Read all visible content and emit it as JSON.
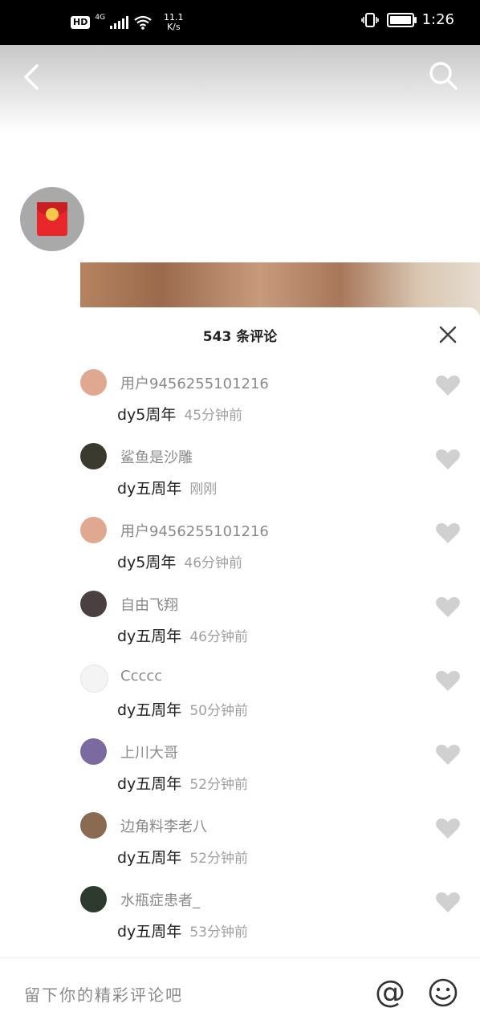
{
  "status_bar": {
    "hd": "HD",
    "network": "4G",
    "speed_value": "11.1",
    "speed_unit": "K/s",
    "time": "1:26"
  },
  "comments_panel": {
    "title": "543 条评论",
    "comments": [
      {
        "user": "用户9456255101216",
        "text": "dy5周年",
        "time": "45分钟前",
        "avatar_color": "#e0a890"
      },
      {
        "user": "鲨鱼是沙雕",
        "text": "dy五周年",
        "time": "刚刚",
        "avatar_color": "#3a3a2e"
      },
      {
        "user": "用户9456255101216",
        "text": "dy5周年",
        "time": "46分钟前",
        "avatar_color": "#e0a890"
      },
      {
        "user": "自由飞翔",
        "text": "dy五周年",
        "time": "46分钟前",
        "avatar_color": "#4a4040"
      },
      {
        "user": "Ccccc",
        "text": "dy五周年",
        "time": "50分钟前",
        "avatar_color": "#f4f4f4"
      },
      {
        "user": "上川大哥",
        "text": "dy五周年",
        "time": "52分钟前",
        "avatar_color": "#7a6aa0"
      },
      {
        "user": "边角料李老八",
        "text": "dy五周年",
        "time": "52分钟前",
        "avatar_color": "#8a6a50"
      },
      {
        "user": "水瓶症患者_",
        "text": "dy五周年",
        "time": "53分钟前",
        "avatar_color": "#2e3a2e"
      }
    ]
  },
  "input_bar": {
    "placeholder": "留下你的精彩评论吧",
    "at_symbol": "@"
  },
  "icons": [
    "back-icon",
    "search-icon",
    "red-packet-icon",
    "close-icon",
    "heart-icon",
    "at-icon",
    "emoji-icon"
  ],
  "colors": {
    "status_bar_bg": "#000000",
    "heart": "#d0d0d0",
    "username": "#8a8a8a",
    "time": "#a0a0a0"
  }
}
